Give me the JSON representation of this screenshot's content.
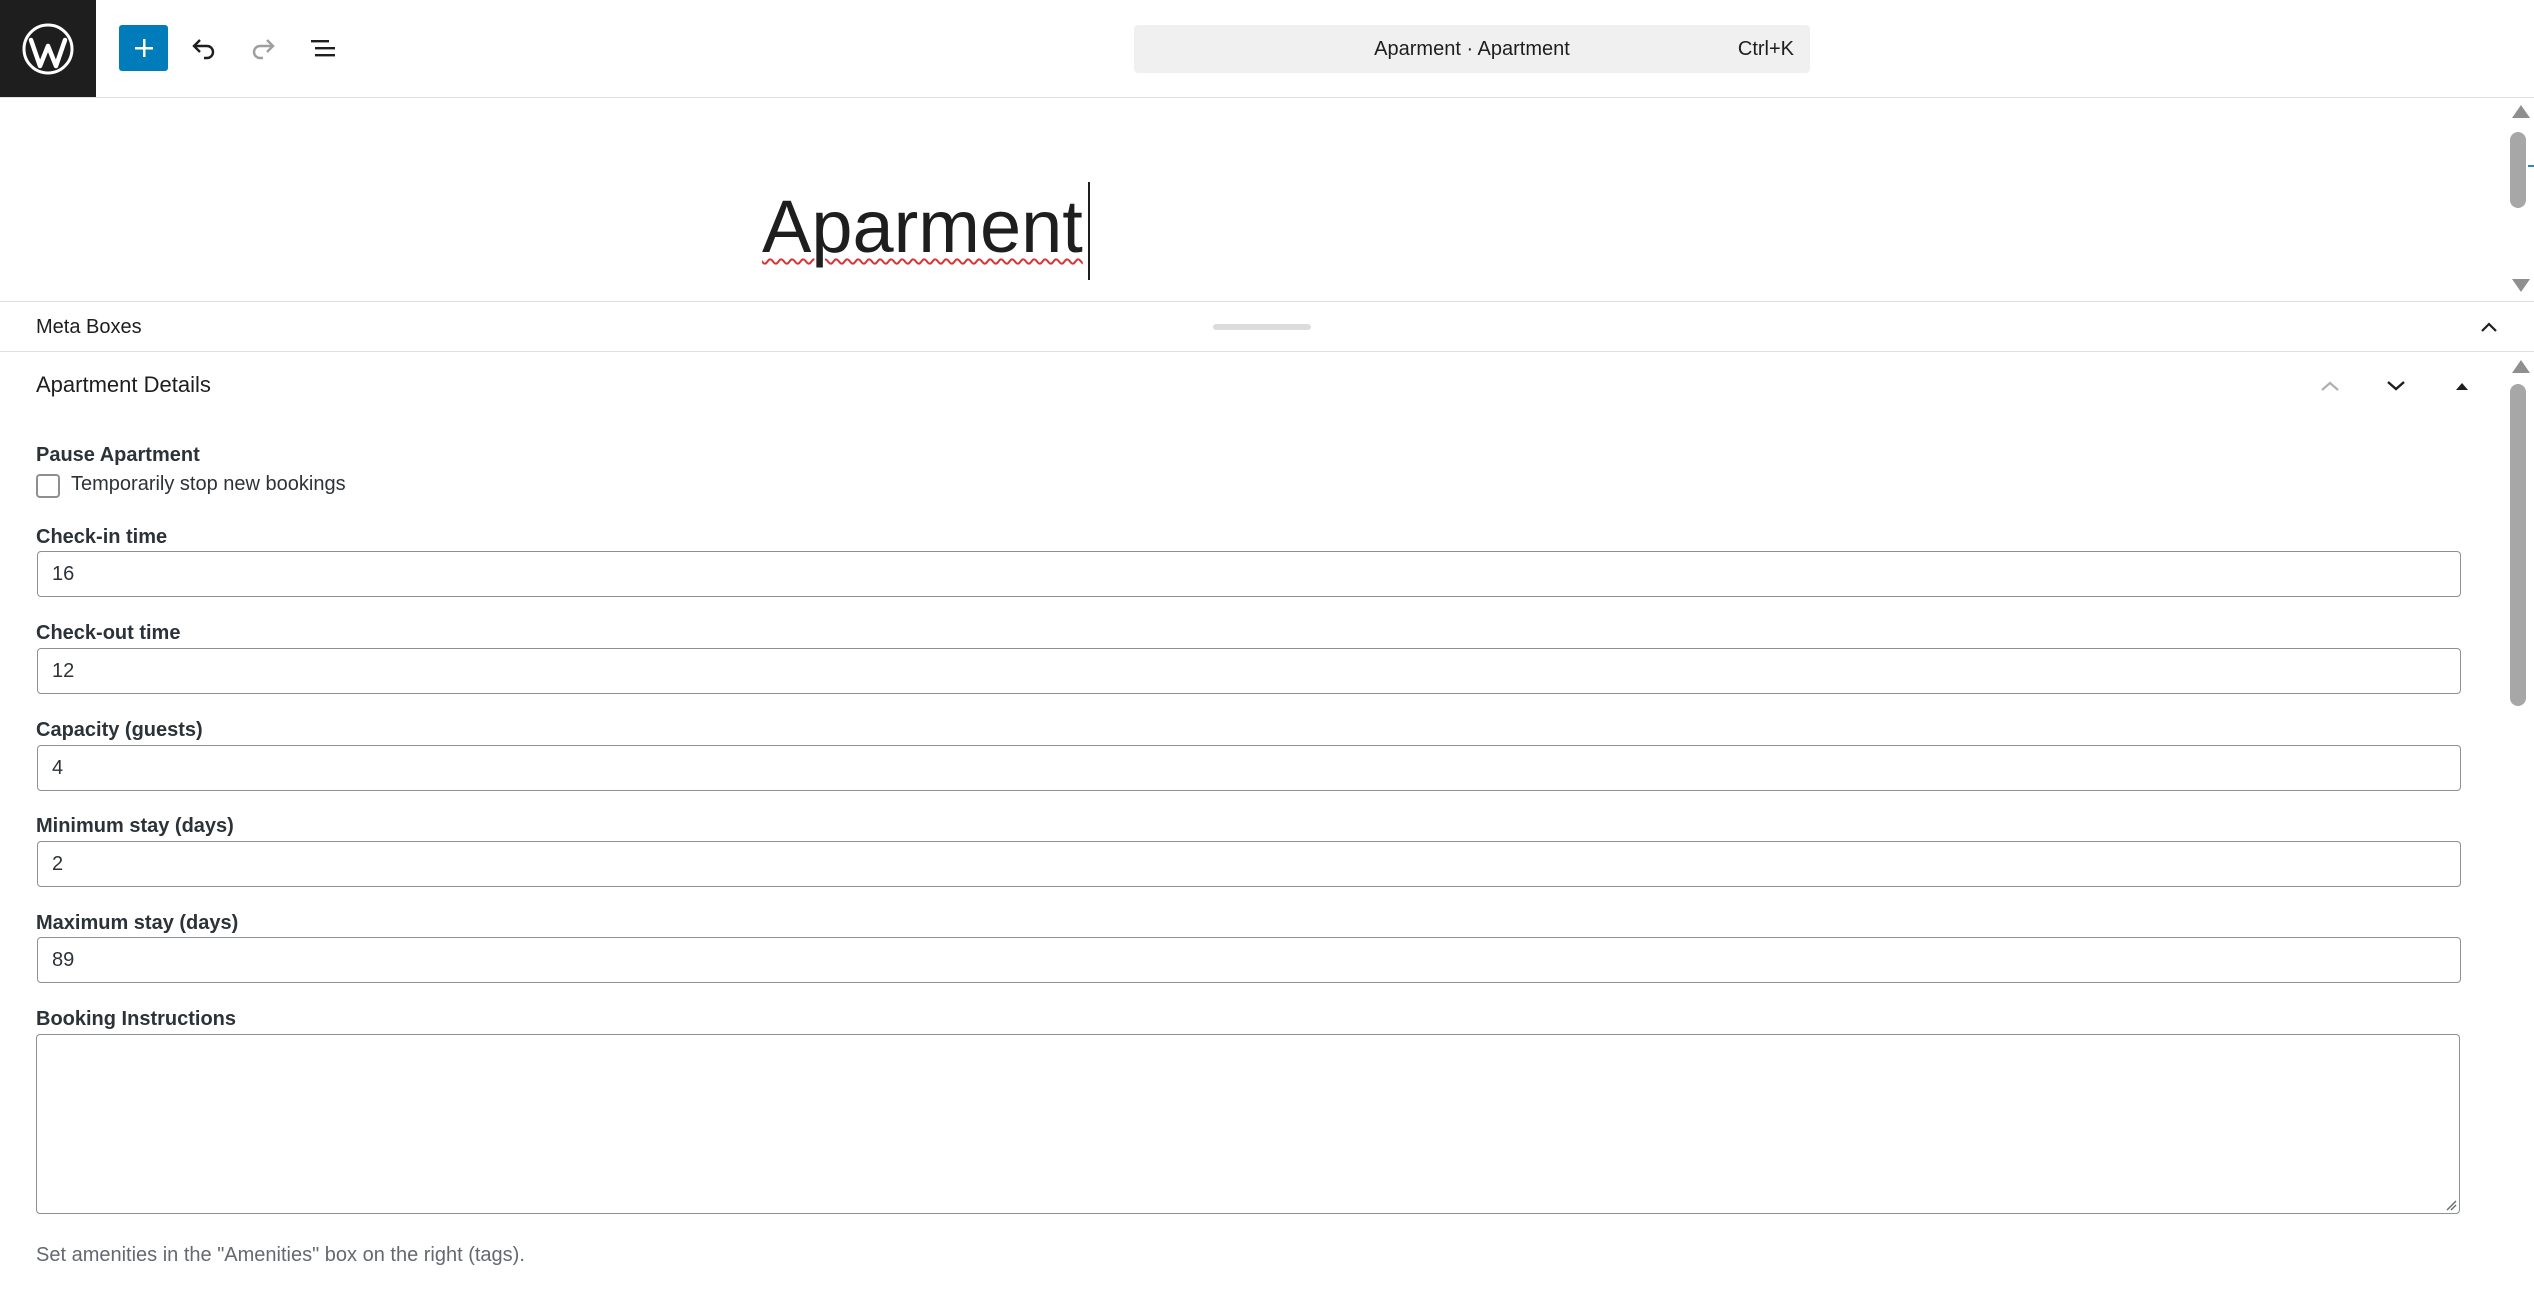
{
  "topbar": {
    "command_bar": {
      "title": "Aparment · Apartment",
      "shortcut": "Ctrl+K"
    },
    "icons": {
      "logo": "wordpress-logo-icon",
      "add": "plus-icon",
      "undo": "undo-icon",
      "redo": "redo-icon",
      "list_view": "list-view-icon"
    }
  },
  "editor": {
    "post_title": "Aparment"
  },
  "meta_boxes": {
    "label": "Meta Boxes",
    "panel": {
      "title": "Apartment Details",
      "fields": {
        "pause": {
          "label": "Pause Apartment",
          "checkbox_label": "Temporarily stop new bookings",
          "checked": false
        },
        "checkin": {
          "label": "Check-in time",
          "value": "16"
        },
        "checkout": {
          "label": "Check-out time",
          "value": "12"
        },
        "capacity": {
          "label": "Capacity (guests)",
          "value": "4"
        },
        "min_stay": {
          "label": "Minimum stay (days)",
          "value": "2"
        },
        "max_stay": {
          "label": "Maximum stay (days)",
          "value": "89"
        },
        "instructions": {
          "label": "Booking Instructions",
          "value": ""
        }
      },
      "help_text": "Set amenities in the \"Amenities\" box on the right (tags)."
    }
  },
  "colors": {
    "accent": "#007cba",
    "logo_bg": "#1e1e1e",
    "command_bar_bg": "#f0f0f0",
    "spellcheck": "#d63638"
  }
}
